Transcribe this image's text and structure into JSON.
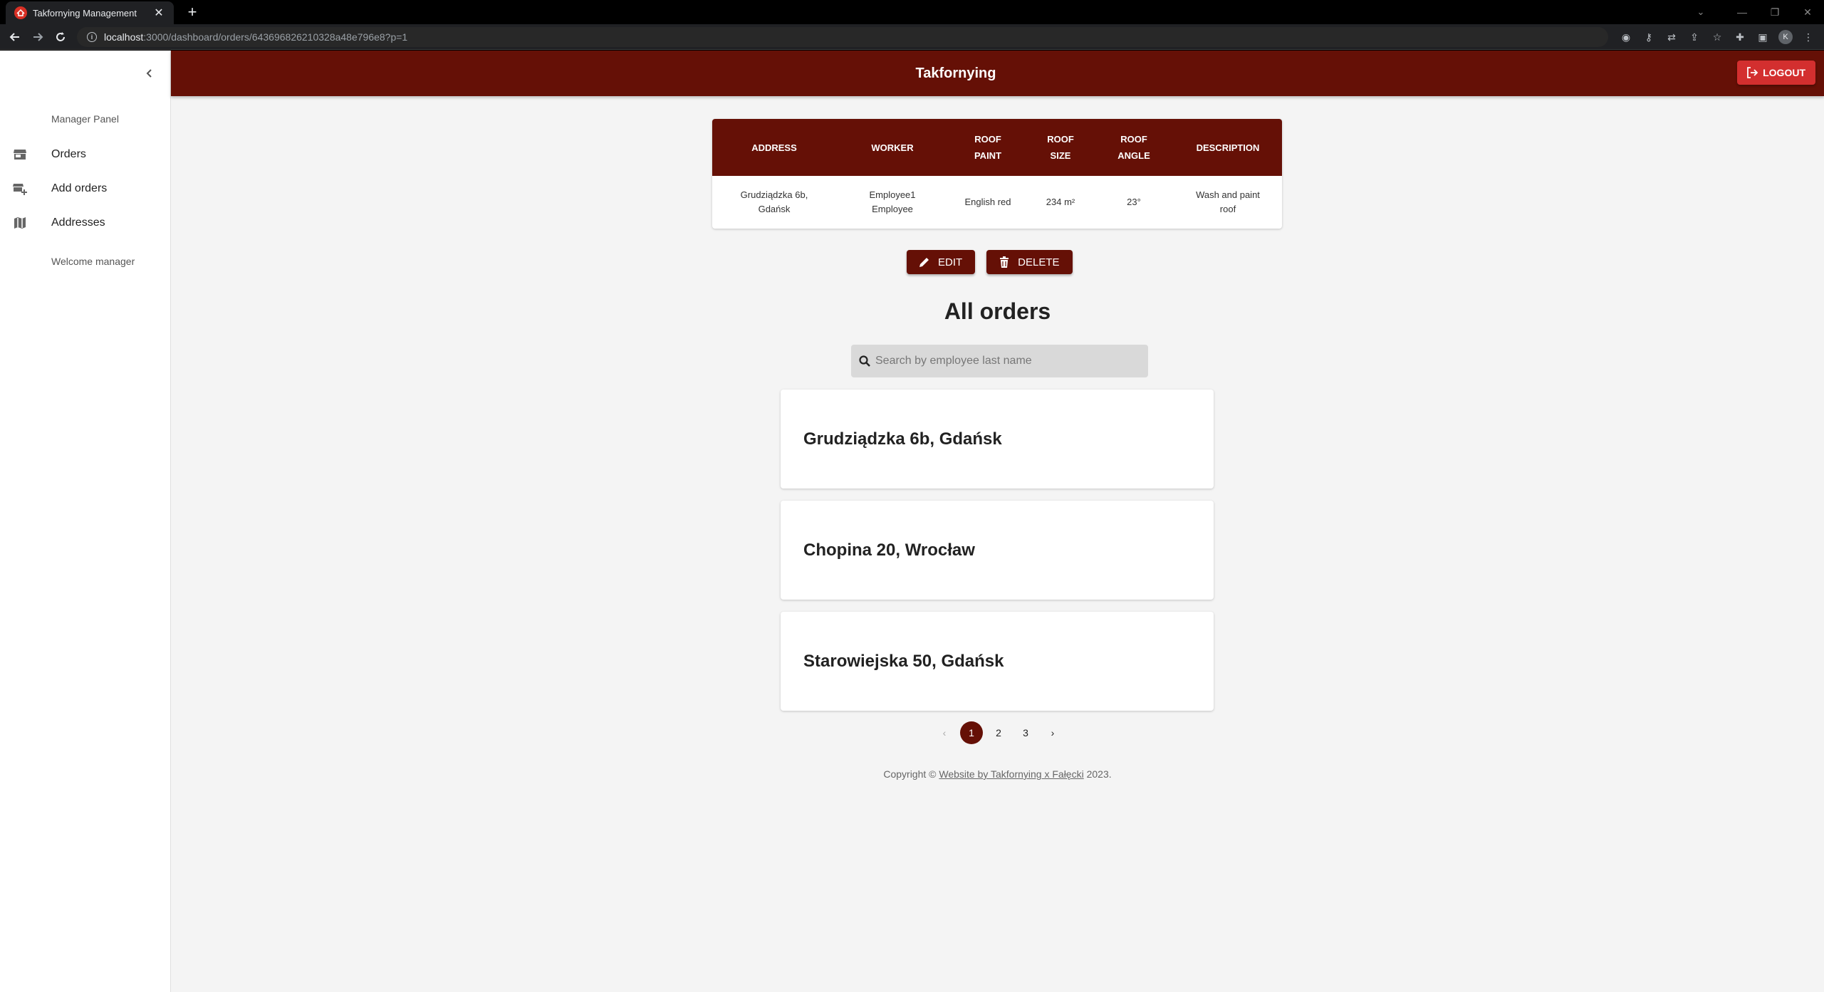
{
  "browser": {
    "tab_title": "Takfornying Management",
    "url_host": "localhost",
    "url_rest": ":3000/dashboard/orders/643696826210328a48e796e8?p=1",
    "profile_initial": "K"
  },
  "app": {
    "title": "Takfornying",
    "logout_label": "LOGOUT"
  },
  "sidebar": {
    "heading": "Manager Panel",
    "items": [
      {
        "label": "Orders",
        "icon": "store-icon"
      },
      {
        "label": "Add orders",
        "icon": "add-business-icon"
      },
      {
        "label": "Addresses",
        "icon": "map-icon"
      }
    ],
    "welcome": "Welcome manager"
  },
  "order_detail": {
    "headers": {
      "address": "ADDRESS",
      "worker": "WORKER",
      "roof_paint_1": "ROOF",
      "roof_paint_2": "PAINT",
      "roof_size_1": "ROOF",
      "roof_size_2": "SIZE",
      "roof_angle_1": "ROOF",
      "roof_angle_2": "ANGLE",
      "description": "DESCRIPTION"
    },
    "row": {
      "address_1": "Grudziądzka 6b,",
      "address_2": "Gdańsk",
      "worker_1": "Employee1",
      "worker_2": "Employee",
      "roof_paint": "English red",
      "roof_size": "234 m²",
      "roof_angle": "23°",
      "description_1": "Wash and paint",
      "description_2": "roof"
    }
  },
  "actions": {
    "edit_label": "EDIT",
    "delete_label": "DELETE"
  },
  "orders": {
    "title": "All orders",
    "search_placeholder": "Search by employee last name",
    "search_value": "",
    "items": [
      {
        "address": "Grudziądzka 6b, Gdańsk"
      },
      {
        "address": "Chopina 20, Wrocław"
      },
      {
        "address": "Starowiejska 50, Gdańsk"
      }
    ]
  },
  "pagination": {
    "pages": [
      "1",
      "2",
      "3"
    ],
    "current": "1"
  },
  "footer": {
    "prefix": "Copyright © ",
    "link": "Website by Takfornying x Fałęcki",
    "suffix": " 2023."
  },
  "colors": {
    "brand": "#651006",
    "logout": "#d32f2f",
    "background": "#f4f4f4"
  }
}
